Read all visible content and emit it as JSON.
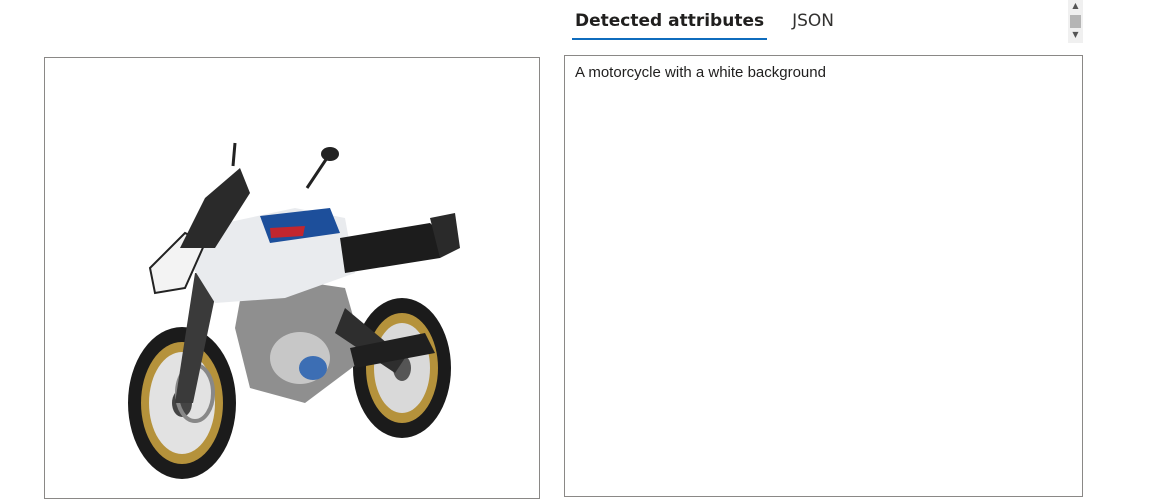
{
  "tabs": [
    {
      "label": "Detected attributes",
      "active": true
    },
    {
      "label": "JSON",
      "active": false
    }
  ],
  "result": {
    "caption": "A motorcycle with a white background"
  },
  "image": {
    "subject": "motorcycle-photo"
  },
  "colors": {
    "tab_underline": "#0f6cbd",
    "border": "#8a8886"
  }
}
